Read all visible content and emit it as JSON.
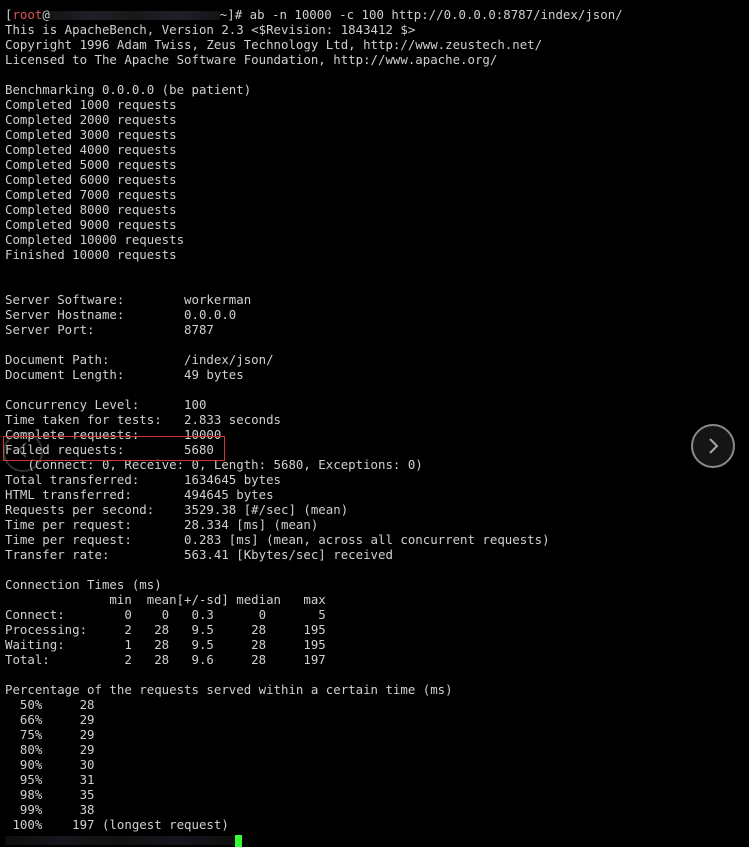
{
  "prompt": {
    "open_bracket": "[",
    "user": "root",
    "at": "@",
    "tail": "~]# ",
    "command": "ab -n 10000 -c 100 http://0.0.0.0:8787/index/json/"
  },
  "output_lines": [
    "This is ApacheBench, Version 2.3 <$Revision: 1843412 $>",
    "Copyright 1996 Adam Twiss, Zeus Technology Ltd, http://www.zeustech.net/",
    "Licensed to The Apache Software Foundation, http://www.apache.org/",
    "",
    "Benchmarking 0.0.0.0 (be patient)",
    "Completed 1000 requests",
    "Completed 2000 requests",
    "Completed 3000 requests",
    "Completed 4000 requests",
    "Completed 5000 requests",
    "Completed 6000 requests",
    "Completed 7000 requests",
    "Completed 8000 requests",
    "Completed 9000 requests",
    "Completed 10000 requests",
    "Finished 10000 requests",
    "",
    "",
    "Server Software:        workerman",
    "Server Hostname:        0.0.0.0",
    "Server Port:            8787",
    "",
    "Document Path:          /index/json/",
    "Document Length:        49 bytes",
    "",
    "Concurrency Level:      100",
    "Time taken for tests:   2.833 seconds",
    "Complete requests:      10000",
    "Failed requests:        5680",
    "   (Connect: 0, Receive: 0, Length: 5680, Exceptions: 0)",
    "Total transferred:      1634645 bytes",
    "HTML transferred:       494645 bytes",
    "Requests per second:    3529.38 [#/sec] (mean)",
    "Time per request:       28.334 [ms] (mean)",
    "Time per request:       0.283 [ms] (mean, across all concurrent requests)",
    "Transfer rate:          563.41 [Kbytes/sec] received",
    "",
    "Connection Times (ms)",
    "              min  mean[+/-sd] median   max",
    "Connect:        0    0   0.3      0       5",
    "Processing:     2   28   9.5     28     195",
    "Waiting:        1   28   9.5     28     195",
    "Total:          2   28   9.6     28     197",
    "",
    "Percentage of the requests served within a certain time (ms)",
    "  50%     28",
    "  66%     29",
    "  75%     29",
    "  80%     29",
    "  90%     30",
    "  95%     31",
    "  98%     35",
    "  99%     38",
    " 100%    197 (longest request)"
  ],
  "colors": {
    "background": "#000000",
    "text": "#d0d0d0",
    "root_user": "#e35252",
    "highlight_box": "#d9342b",
    "cursor": "#33ff33"
  },
  "icons": {
    "next": "chevron-right-icon",
    "prev": "chevron-left-icon"
  }
}
